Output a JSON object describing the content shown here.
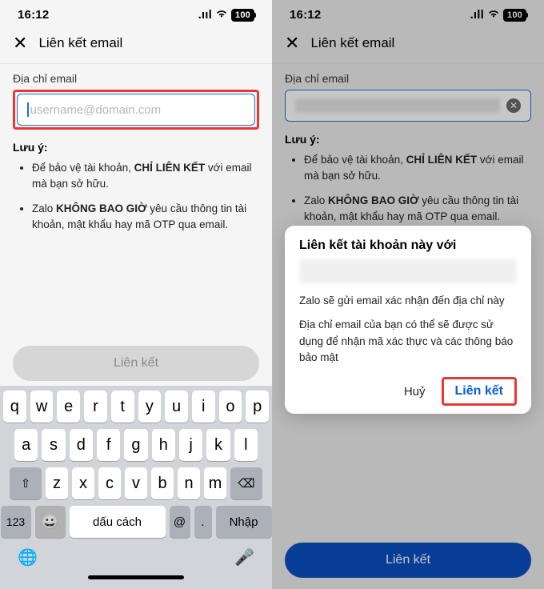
{
  "left": {
    "status": {
      "time": "16:12",
      "battery": "100"
    },
    "header": {
      "title": "Liên kết email"
    },
    "field_label": "Địa chỉ email",
    "placeholder": "username@domain.com",
    "hint_title": "Lưu ý:",
    "hint1_pre": "Để bảo vệ tài khoản, ",
    "hint1_bold": "CHỈ LIÊN KẾT",
    "hint1_post": " với email mà bạn sở hữu.",
    "hint2_pre": "Zalo ",
    "hint2_bold": "KHÔNG BAO GIỜ",
    "hint2_post": " yêu cầu thông tin tài khoản, mật khẩu hay mã OTP qua email.",
    "link_button": "Liên kết",
    "keyboard": {
      "row1": [
        "q",
        "w",
        "e",
        "r",
        "t",
        "y",
        "u",
        "i",
        "o",
        "p"
      ],
      "row2": [
        "a",
        "s",
        "d",
        "f",
        "g",
        "h",
        "j",
        "k",
        "l"
      ],
      "row3": [
        "z",
        "x",
        "c",
        "v",
        "b",
        "n",
        "m"
      ],
      "num": "123",
      "space": "dấu cách",
      "at": "@",
      "dot": ".",
      "enter": "Nhập",
      "shift": "⇧",
      "backspace": "⌫",
      "emoji": "😀"
    }
  },
  "right": {
    "status": {
      "time": "16:12",
      "battery": "100"
    },
    "header": {
      "title": "Liên kết email"
    },
    "field_label": "Địa chỉ email",
    "hint_title": "Lưu ý:",
    "hint1_pre": "Để bảo vệ tài khoản, ",
    "hint1_bold": "CHỈ LIÊN KẾT",
    "hint1_post": " với email mà bạn sở hữu.",
    "hint2_pre": "Zalo ",
    "hint2_bold": "KHÔNG BAO GIỜ",
    "hint2_post": " yêu cầu thông tin tài khoản, mật khẩu hay mã OTP qua email.",
    "dialog": {
      "title": "Liên kết tài khoản này với",
      "body1": "Zalo sẽ gửi email xác nhận đến địa chỉ này",
      "body2": "Địa chỉ email của bạn có thể sẽ được sử dụng để nhận mã xác thực và các thông báo bảo mật",
      "cancel": "Huỷ",
      "confirm": "Liên kết"
    },
    "primary_button": "Liên kết"
  }
}
